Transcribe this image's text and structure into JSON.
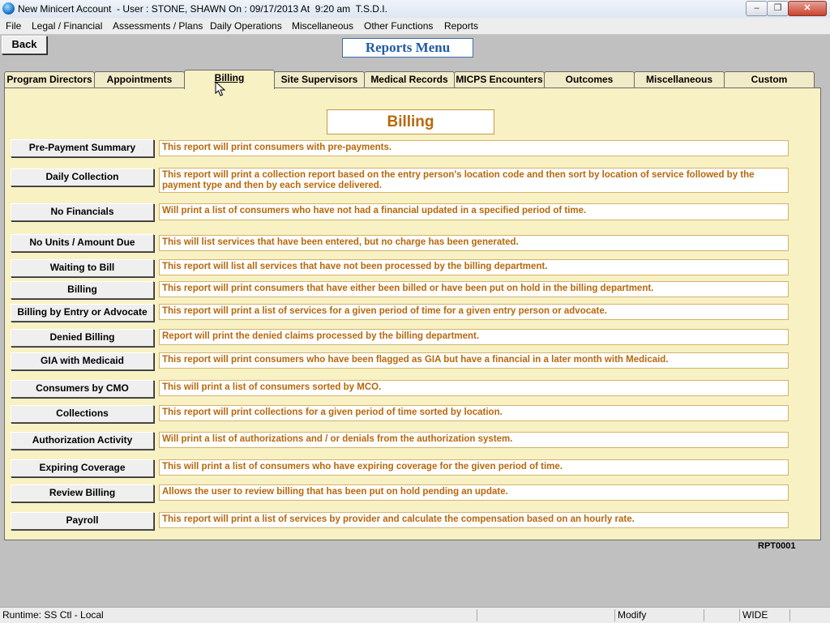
{
  "window": {
    "title": "New Minicert Account  - User : STONE, SHAWN On : 09/17/2013 At  9:20 am  T.S.D.I.",
    "min_glyph": "–",
    "max_glyph": "❐",
    "close_glyph": "✕"
  },
  "menu": [
    "File",
    "Legal / Financial",
    "Assessments / Plans",
    "Daily Operations",
    "Miscellaneous",
    "Other Functions",
    "Reports"
  ],
  "back_label": "Back",
  "page_title": "Reports Menu",
  "tabs": [
    "Program Directors",
    "Appointments",
    "Billing",
    "Site Supervisors",
    "Medical Records",
    "MICPS Encounters",
    "Outcomes",
    "Miscellaneous",
    "Custom"
  ],
  "active_tab": "Billing",
  "section_title": "Billing",
  "reports": [
    {
      "label": "Pre-Payment Summary",
      "desc": "This report will print consumers with pre-payments."
    },
    {
      "label": "Daily Collection",
      "desc": "This report will print a collection report based on the entry person's location code and then sort by location of service followed by the payment type and then by each service delivered."
    },
    {
      "label": "No Financials",
      "desc": "Will print a list of consumers who have not had a financial updated in a specified period of time."
    },
    {
      "label": "No Units / Amount Due",
      "desc": "This will list services that have been entered, but no charge has been generated."
    },
    {
      "label": "Waiting to Bill",
      "desc": "This report will list all services that have not been processed by the billing department."
    },
    {
      "label": "Billing",
      "desc": "This report will print consumers that have either been billed or have been put on hold in the billing department."
    },
    {
      "label": "Billing by Entry or Advocate",
      "desc": "This report will print a list of services for a given period of time for a given entry person or advocate."
    },
    {
      "label": "Denied Billing",
      "desc": "Report will print the denied claims processed by the billing department."
    },
    {
      "label": "GIA with Medicaid",
      "desc": "This report will print consumers who have been flagged as GIA but have a financial in a later month with Medicaid."
    },
    {
      "label": "Consumers by CMO",
      "desc": "This will print a list of consumers sorted by MCO."
    },
    {
      "label": "Collections",
      "desc": "This report will print collections for a given period of time sorted by location."
    },
    {
      "label": "Authorization Activity",
      "desc": "Will print a list of authorizations and / or denials from the authorization system."
    },
    {
      "label": "Expiring Coverage",
      "desc": "This will print a list of consumers who have expiring coverage for the given period of time."
    },
    {
      "label": "Review Billing",
      "desc": "Allows the user to review billing that has been put on hold pending an update."
    },
    {
      "label": "Payroll",
      "desc": "This report will print a list of services by provider and calculate the compensation based on an hourly rate."
    }
  ],
  "report_code": "RPT0001",
  "status": {
    "runtime": "Runtime: SS Ctl - Local",
    "mode": "Modify",
    "width": "WIDE"
  }
}
